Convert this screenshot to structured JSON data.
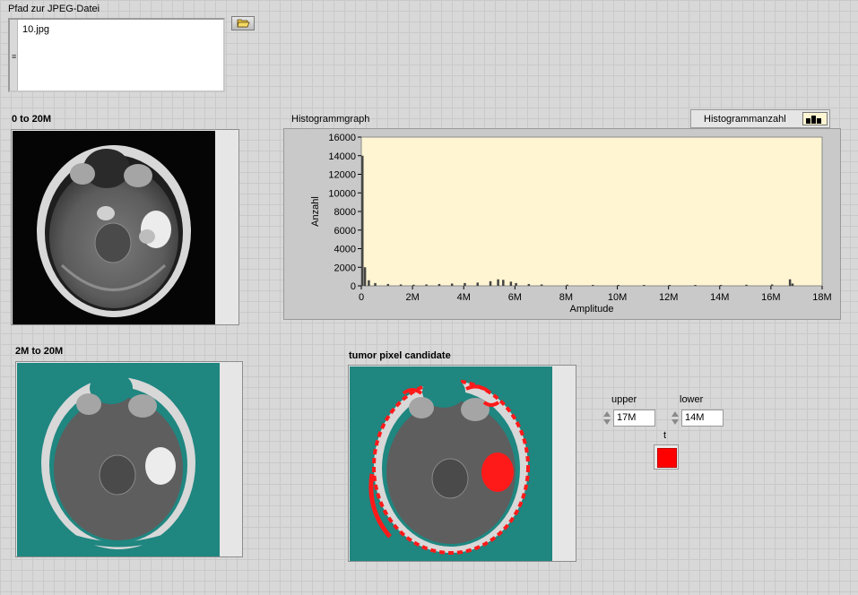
{
  "path_control": {
    "label": "Pfad zur JPEG-Datei",
    "value": "10.jpg"
  },
  "image1": {
    "label": "0 to 20M"
  },
  "image2": {
    "label": "2M to 20M"
  },
  "image3": {
    "label": "tumor pixel candidate"
  },
  "histogram": {
    "label": "Histogrammgraph",
    "legend_label": "Histogrammanzahl",
    "colors": {
      "plot_bg": "#fff5d2",
      "bars": "#454545"
    }
  },
  "controls": {
    "upper": {
      "label": "upper",
      "value": "17M"
    },
    "lower": {
      "label": "lower",
      "value": "14M"
    },
    "indicator": {
      "label": "t",
      "color": "#ff0000"
    }
  },
  "chart_data": {
    "type": "bar",
    "xlabel": "Amplitude",
    "ylabel": "Anzahl",
    "xlim": [
      0,
      18000000
    ],
    "ylim": [
      0,
      16000
    ],
    "xticks": [
      "0",
      "2M",
      "4M",
      "6M",
      "8M",
      "10M",
      "12M",
      "14M",
      "16M",
      "18M"
    ],
    "yticks": [
      "0",
      "2000",
      "4000",
      "6000",
      "8000",
      "10000",
      "12000",
      "14000",
      "16000"
    ],
    "series": [
      {
        "x": [
          0,
          100000,
          250000,
          500000,
          1000000,
          1500000,
          2000000,
          2500000,
          3000000,
          3500000,
          4000000,
          4500000,
          5000000,
          5300000,
          5500000,
          5800000,
          6000000,
          6500000,
          7000000,
          8000000,
          9000000,
          10000000,
          11000000,
          12000000,
          13000000,
          14000000,
          15000000,
          16000000,
          16700000,
          16800000
        ],
        "values": [
          14000,
          2000,
          600,
          300,
          200,
          150,
          120,
          150,
          200,
          250,
          300,
          350,
          500,
          700,
          650,
          450,
          300,
          200,
          150,
          120,
          100,
          100,
          100,
          100,
          100,
          100,
          120,
          150,
          700,
          250
        ]
      }
    ]
  }
}
